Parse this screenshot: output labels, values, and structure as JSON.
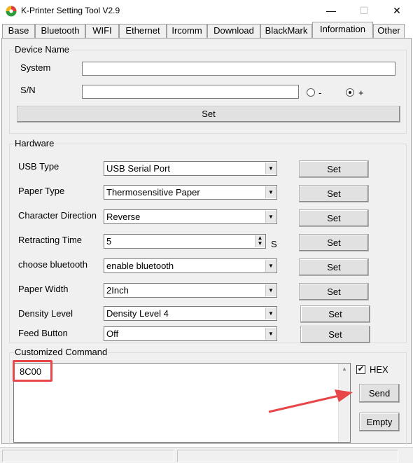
{
  "window": {
    "title": "K-Printer Setting Tool V2.9",
    "minimize_glyph": "—",
    "maximize_glyph": "☐",
    "close_glyph": "✕"
  },
  "tabs": [
    {
      "label": "Base"
    },
    {
      "label": "Bluetooth"
    },
    {
      "label": "WIFI"
    },
    {
      "label": "Ethernet"
    },
    {
      "label": "Ircomm"
    },
    {
      "label": "Download"
    },
    {
      "label": "BlackMark"
    },
    {
      "label": "Information",
      "active": true
    },
    {
      "label": "Other"
    }
  ],
  "device_name": {
    "legend": "Device Name",
    "system_label": "System",
    "system_value": "",
    "sn_label": "S/N",
    "sn_value": "",
    "radio_minus_label": "-",
    "radio_plus_label": "+",
    "radio_selected": "+",
    "set_label": "Set"
  },
  "hardware": {
    "legend": "Hardware",
    "rows": [
      {
        "label": "USB  Type",
        "value": "USB Serial Port",
        "set_label": "Set"
      },
      {
        "label": "Paper Type",
        "value": "Thermosensitive Paper",
        "set_label": "Set"
      },
      {
        "label": "Character Direction",
        "value": "Reverse",
        "set_label": "Set"
      },
      {
        "label": "Retracting Time",
        "value": "5",
        "unit": "S",
        "set_label": "Set"
      },
      {
        "label": "choose bluetooth",
        "value": "enable bluetooth",
        "set_label": "Set"
      },
      {
        "label": "Paper Width",
        "value": "2Inch",
        "set_label": "Set"
      },
      {
        "label": "Density Level",
        "value": "Density Level 4",
        "set_label": "Set"
      },
      {
        "label": "Feed Button",
        "value": "Off",
        "set_label": "Set"
      }
    ]
  },
  "customized_command": {
    "legend": "Customized Command",
    "command_text": "8C00",
    "hex_label": "HEX",
    "hex_checked": true,
    "send_label": "Send",
    "empty_label": "Empty"
  },
  "icons": {
    "app": "app-logo-icon",
    "dropdown": "chevron-down-icon",
    "spinner": "spinner-icon",
    "scroll_up": "scroll-up-icon",
    "scroll_down": "scroll-down-icon",
    "checkmark": "checkmark-icon",
    "annotation_arrow": "annotation-arrow-icon"
  },
  "colors": {
    "highlight": "#e8474a",
    "panel": "#f0f0f0",
    "button": "#e1e1e1"
  }
}
